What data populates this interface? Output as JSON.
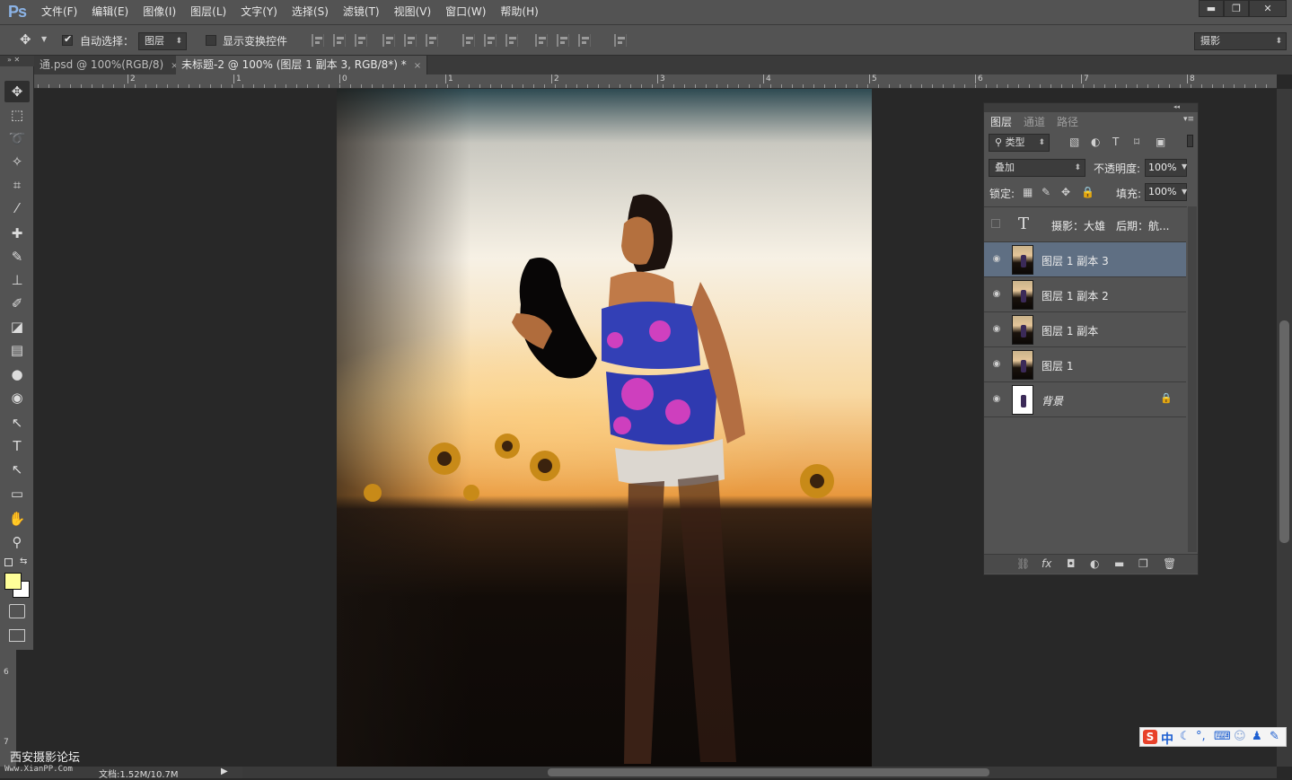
{
  "app": {
    "logo": "Ps"
  },
  "menubar": {
    "items": [
      "文件(F)",
      "编辑(E)",
      "图像(I)",
      "图层(L)",
      "文字(Y)",
      "选择(S)",
      "滤镜(T)",
      "视图(V)",
      "窗口(W)",
      "帮助(H)"
    ],
    "window_buttons": {
      "minimize": "▬",
      "restore": "❐",
      "close": "✕"
    }
  },
  "options": {
    "move_icon": "move-tool-icon",
    "auto_select_label": "自动选择：",
    "auto_select_target": "图层",
    "show_transform_label": "显示变换控件",
    "workspace": "摄影"
  },
  "tabs": [
    {
      "title": "通.psd @ 100%(RGB/8)",
      "close": "×",
      "active": false
    },
    {
      "title": "未标题-2 @ 100% (图层 1 副本 3, RGB/8*) *",
      "close": "×",
      "active": true
    }
  ],
  "ruler": {
    "top": [
      "2",
      "1",
      "0",
      "1",
      "2",
      "3",
      "4",
      "5",
      "6",
      "7",
      "8"
    ],
    "left": [
      "6",
      "7"
    ]
  },
  "tools": [
    "move-tool-icon",
    "marquee-tool-icon",
    "lasso-tool-icon",
    "magic-wand-icon",
    "crop-tool-icon",
    "eyedropper-icon",
    "healing-brush-icon",
    "brush-tool-icon",
    "stamp-tool-icon",
    "history-brush-icon",
    "eraser-tool-icon",
    "gradient-tool-icon",
    "blur-tool-icon",
    "dodge-tool-icon",
    "path-select-icon",
    "type-tool-icon",
    "direct-select-icon",
    "shape-tool-icon",
    "hand-tool-icon",
    "zoom-tool-icon"
  ],
  "tool_glyphs": [
    "✥",
    "⬚",
    "➰",
    "✧",
    "⌗",
    "⁄",
    "✚",
    "✎",
    "⊥",
    "✐",
    "◪",
    "▤",
    "●",
    "◉",
    "↖",
    "T",
    "↖",
    "▭",
    "✋",
    "⚲"
  ],
  "colors": {
    "foreground": "#ffff99",
    "background": "#ffffff",
    "selection": "#5f6f83",
    "canvas": "#282828",
    "chrome": "#535353"
  },
  "layers_panel": {
    "tabs": [
      "图层",
      "通道",
      "路径"
    ],
    "filter_label": "类型",
    "blend_mode": "叠加",
    "opacity_label": "不透明度:",
    "opacity_value": "100%",
    "lock_label": "锁定:",
    "fill_label": "填充:",
    "fill_value": "100%",
    "layers": [
      {
        "name": "摄影：大雄　后期：航...",
        "kind": "text",
        "visible": false,
        "selected": false
      },
      {
        "name": "图层 1 副本 3",
        "kind": "image",
        "visible": true,
        "selected": true
      },
      {
        "name": "图层 1 副本 2",
        "kind": "image",
        "visible": true,
        "selected": false
      },
      {
        "name": "图层 1 副本",
        "kind": "image",
        "visible": true,
        "selected": false
      },
      {
        "name": "图层 1",
        "kind": "image",
        "visible": true,
        "selected": false
      },
      {
        "name": "背景",
        "kind": "background",
        "visible": true,
        "selected": false,
        "locked": true
      }
    ],
    "footer_icons": [
      "link-icon",
      "fx-icon",
      "mask-icon",
      "adjustment-icon",
      "folder-icon",
      "new-layer-icon",
      "trash-icon"
    ]
  },
  "status": {
    "doc_info": "文档:1.52M/10.7M"
  },
  "watermark": {
    "site": "西安摄影论坛",
    "url": "Www.XianPP.Com"
  },
  "ime": {
    "mode": "中"
  }
}
